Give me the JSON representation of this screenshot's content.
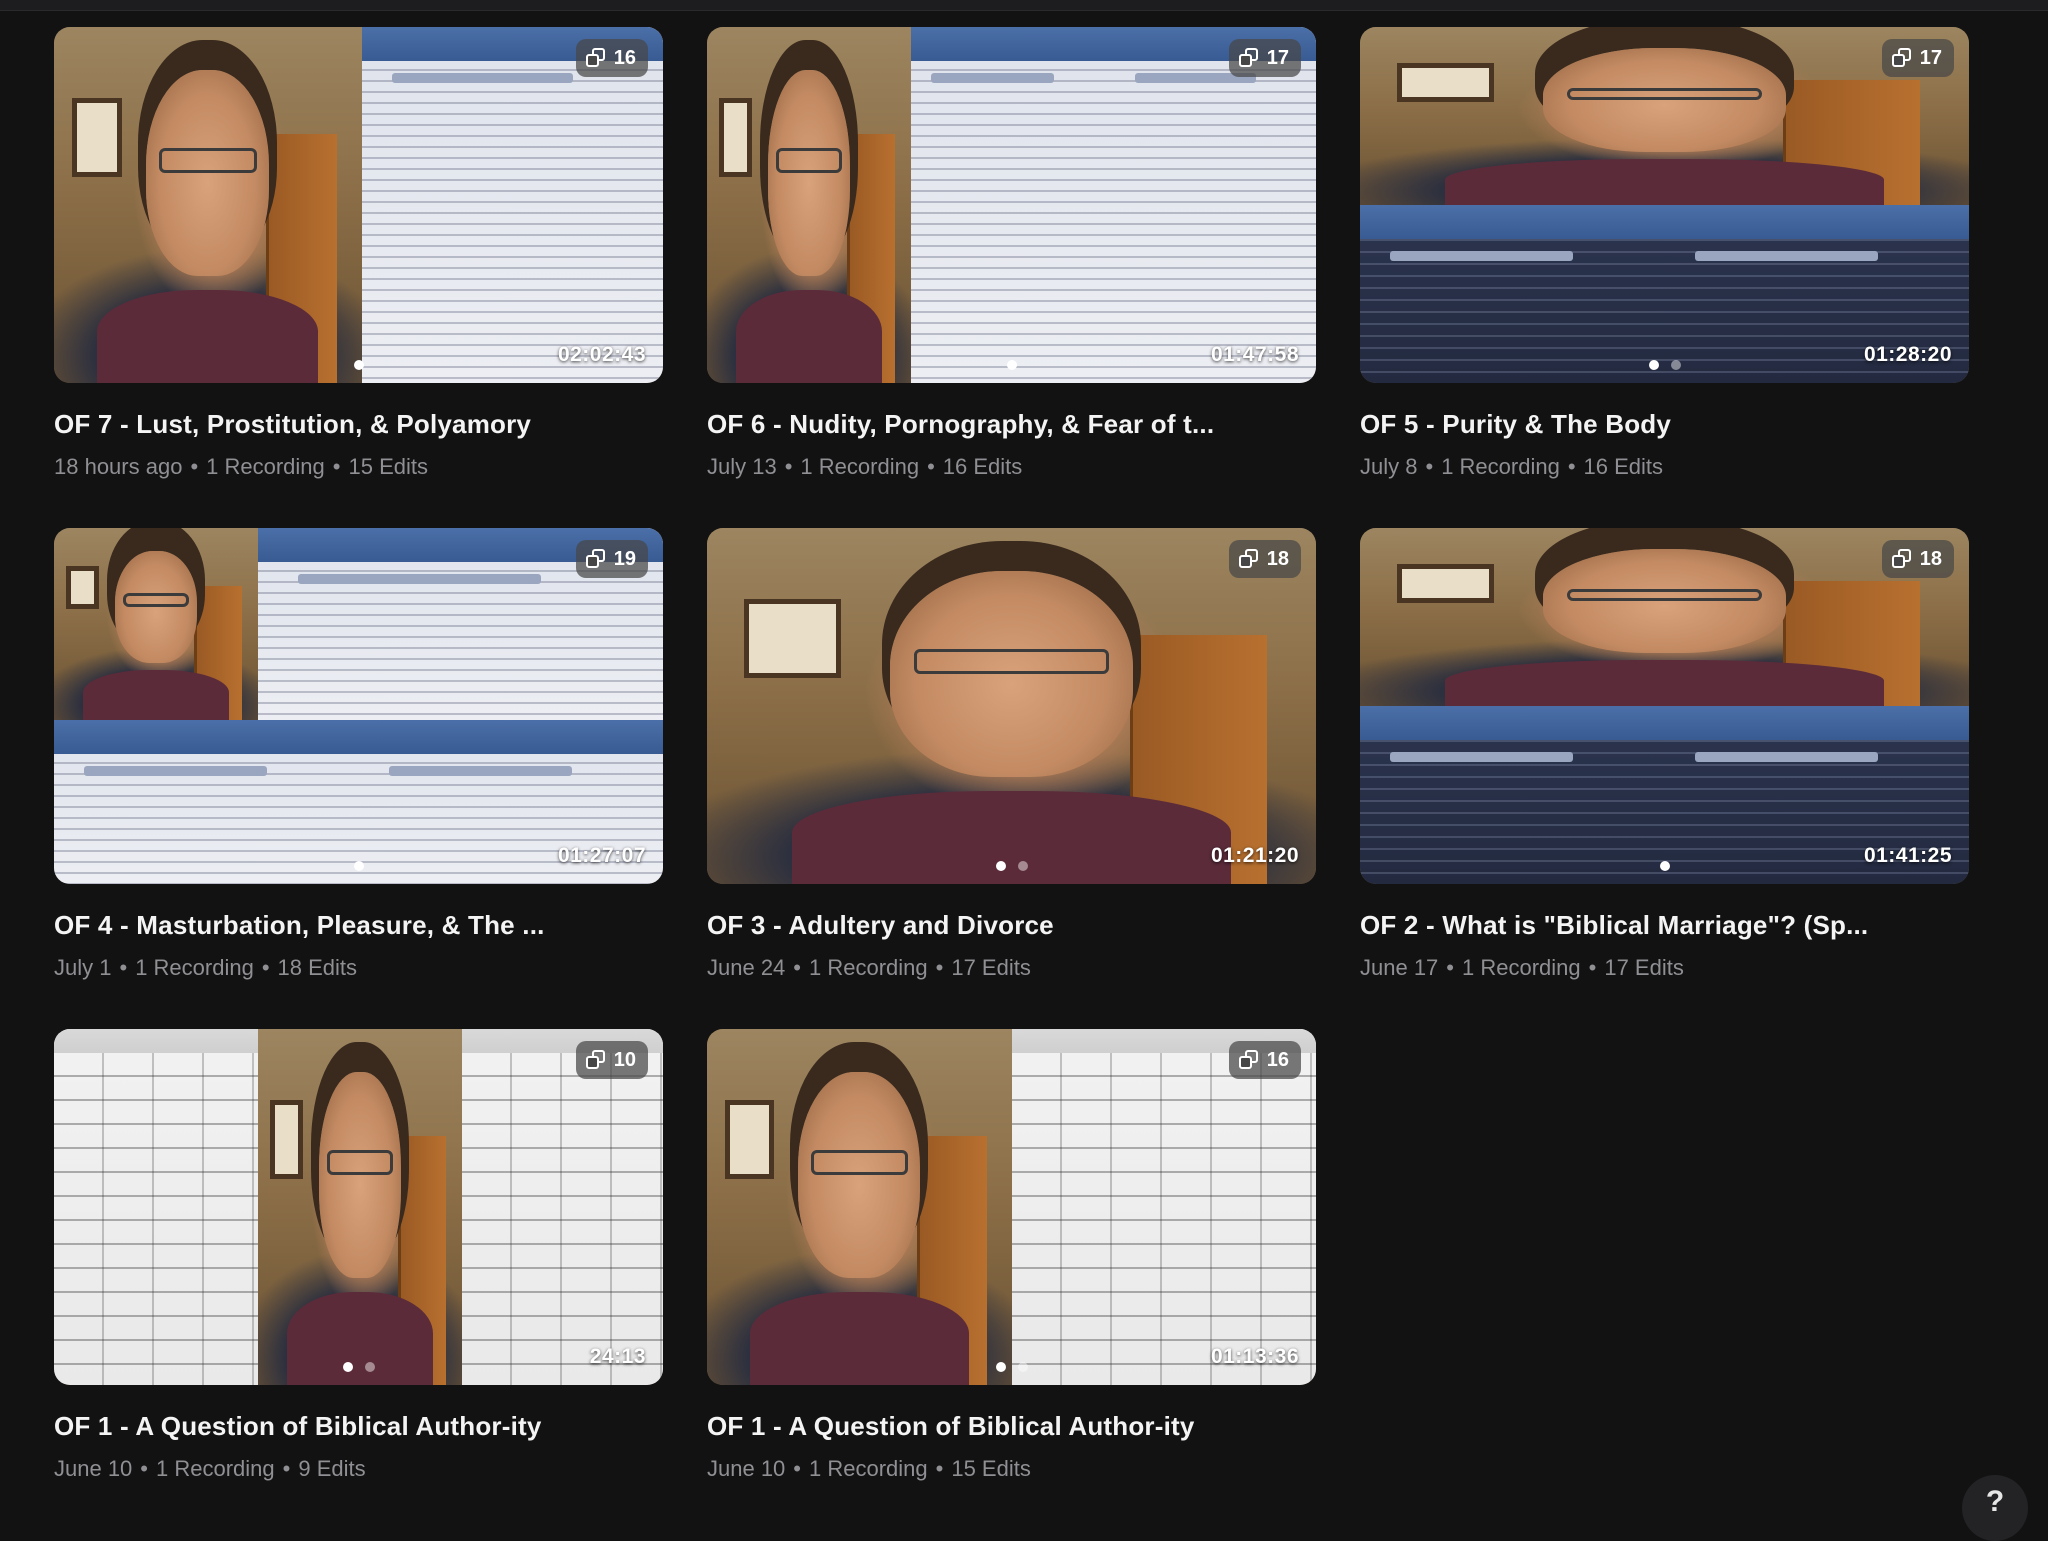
{
  "help_button_label": "?",
  "meta_separator": "•",
  "cards": [
    {
      "title": "OF 7 - Lust, Prostitution, & Polyamory",
      "date": "18 hours ago",
      "recordings": "1 Recording",
      "edits": "15 Edits",
      "clip_count": "16",
      "duration": "02:02:43",
      "layout": "cam-doc",
      "dots": 1
    },
    {
      "title": "OF 6 - Nudity, Pornography, & Fear of t...",
      "date": "July 13",
      "recordings": "1 Recording",
      "edits": "16 Edits",
      "clip_count": "17",
      "duration": "01:47:58",
      "layout": "cam-doc-doc",
      "dots": 1
    },
    {
      "title": "OF 5 - Purity & The Body",
      "date": "July 8",
      "recordings": "1 Recording",
      "edits": "16 Edits",
      "clip_count": "17",
      "duration": "01:28:20",
      "layout": "cam-top-docs",
      "dots": 2
    },
    {
      "title": "OF 4 - Masturbation, Pleasure, & The ...",
      "date": "July 1",
      "recordings": "1 Recording",
      "edits": "18 Edits",
      "clip_count": "19",
      "duration": "01:27:07",
      "layout": "cam-small-docs",
      "dots": 1
    },
    {
      "title": "OF 3 - Adultery and Divorce",
      "date": "June 24",
      "recordings": "1 Recording",
      "edits": "17 Edits",
      "clip_count": "18",
      "duration": "01:21:20",
      "layout": "cam-full",
      "dots": 2
    },
    {
      "title": "OF 2 - What is \"Biblical Marriage\"? (Sp...",
      "date": "June 17",
      "recordings": "1 Recording",
      "edits": "17 Edits",
      "clip_count": "18",
      "duration": "01:41:25",
      "layout": "cam-top-docs",
      "dots": 1
    },
    {
      "title": "OF 1 - A Question of Biblical Author-ity",
      "date": "June 10",
      "recordings": "1 Recording",
      "edits": "9 Edits",
      "clip_count": "10",
      "duration": "24:13",
      "layout": "table-cam-table",
      "dots": 2
    },
    {
      "title": "OF 1 - A Question of Biblical Author-ity",
      "date": "June 10",
      "recordings": "1 Recording",
      "edits": "15 Edits",
      "clip_count": "16",
      "duration": "01:13:36",
      "layout": "cam-table",
      "dots": 2
    }
  ]
}
